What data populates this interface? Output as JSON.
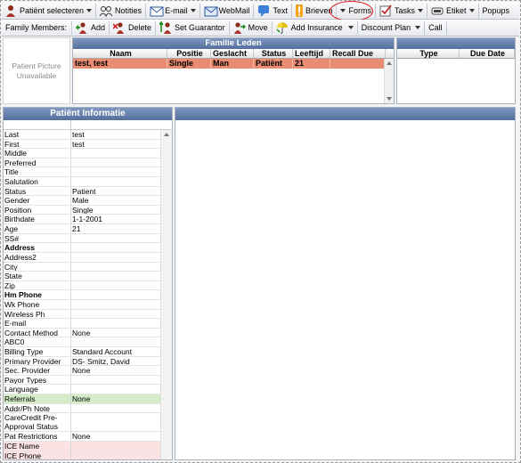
{
  "toolbar": {
    "patient_select": "Patiënt selecteren",
    "notes": "Notities",
    "email": "E-mail",
    "webmail": "WebMail",
    "text": "Text",
    "letters": "Brieven",
    "forms": "Forms",
    "tasks": "Tasks",
    "label": "Etiket",
    "popups": "Popups"
  },
  "family_toolbar": {
    "label": "Family Members:",
    "add": "Add",
    "delete": "Delete",
    "set_guarantor": "Set Guarantor",
    "move": "Move",
    "add_insurance": "Add Insurance",
    "discount_plan": "Discount Plan",
    "call": "Call"
  },
  "picture": {
    "text": "Patient Picture Unavailable"
  },
  "family": {
    "title": "Familie Leden",
    "columns": [
      "Naam",
      "Positie",
      "Geslacht",
      "Status",
      "Leeftijd",
      "Recall Due"
    ],
    "rows": [
      [
        "test, test",
        "Single",
        "Man",
        "Patiënt",
        "21",
        ""
      ]
    ]
  },
  "tasks": {
    "columns": [
      "Type",
      "Due Date"
    ]
  },
  "patient_info": {
    "title": "Patiënt Informatie",
    "rows": [
      {
        "k": "Last",
        "v": "test"
      },
      {
        "k": "First",
        "v": "test"
      },
      {
        "k": "Middle",
        "v": ""
      },
      {
        "k": "Preferred",
        "v": ""
      },
      {
        "k": "Title",
        "v": ""
      },
      {
        "k": "Salutation",
        "v": ""
      },
      {
        "k": "Status",
        "v": "Patient"
      },
      {
        "k": "Gender",
        "v": "Male"
      },
      {
        "k": "Position",
        "v": "Single"
      },
      {
        "k": "Birthdate",
        "v": "1-1-2001"
      },
      {
        "k": "Age",
        "v": "21"
      },
      {
        "k": "SS#",
        "v": ""
      },
      {
        "k": "Address",
        "v": ""
      },
      {
        "k": "Address2",
        "v": ""
      },
      {
        "k": "City",
        "v": ""
      },
      {
        "k": "State",
        "v": ""
      },
      {
        "k": "Zip",
        "v": ""
      },
      {
        "k": "Hm Phone",
        "v": ""
      },
      {
        "k": "Wk Phone",
        "v": ""
      },
      {
        "k": "Wireless Ph",
        "v": ""
      },
      {
        "k": "E-mail",
        "v": ""
      },
      {
        "k": "Contact Method",
        "v": "None"
      },
      {
        "k": "ABC0",
        "v": ""
      },
      {
        "k": "Billing Type",
        "v": "Standard Account"
      },
      {
        "k": "Primary Provider",
        "v": "DS- Smitz, David"
      },
      {
        "k": "Sec. Provider",
        "v": "None"
      },
      {
        "k": "Payor Types",
        "v": ""
      },
      {
        "k": "Language",
        "v": ""
      },
      {
        "k": "Referrals",
        "v": "None"
      },
      {
        "k": "Addr/Ph Note",
        "v": ""
      },
      {
        "k": "CareCredit Pre-Approval Status",
        "v": ""
      },
      {
        "k": "Pat Restrictions",
        "v": "None"
      },
      {
        "k": "ICE Name",
        "v": ""
      },
      {
        "k": "ICE Phone",
        "v": ""
      }
    ]
  }
}
